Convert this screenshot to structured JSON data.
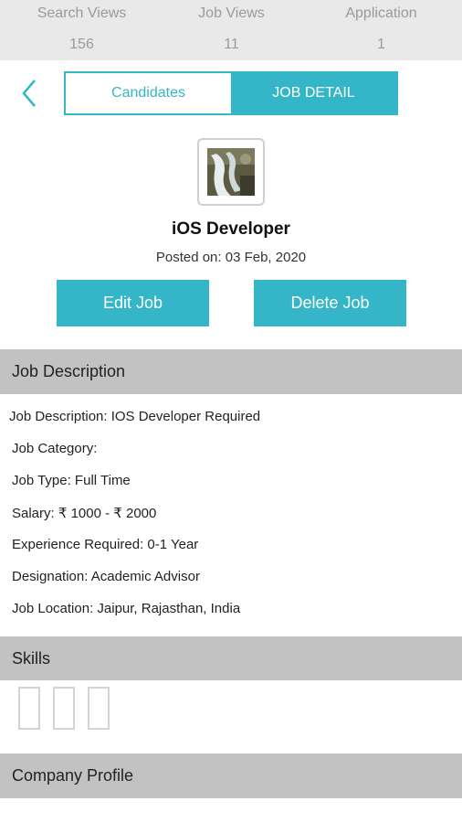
{
  "stats": [
    {
      "label": "Search Views",
      "value": "156"
    },
    {
      "label": "Job Views",
      "value": "11"
    },
    {
      "label": "Application",
      "value": "1"
    }
  ],
  "tabs": {
    "candidates": "Candidates",
    "job_detail": "JOB DETAIL"
  },
  "job": {
    "title": "iOS Developer",
    "posted": "Posted on: 03 Feb, 2020"
  },
  "actions": {
    "edit": "Edit Job",
    "delete": "Delete Job"
  },
  "sections": {
    "job_description": "Job Description",
    "skills": "Skills",
    "company_profile": "Company Profile"
  },
  "details": [
    "Job Description: IOS Developer Required",
    "Job Category:",
    "Job Type: Full Time",
    "Salary: ₹ 1000 - ₹ 2000",
    "Experience Required: 0-1 Year",
    "Designation: Academic Advisor",
    "Job Location: Jaipur, Rajasthan, India"
  ],
  "colors": {
    "accent": "#35b5c8",
    "section_bg": "#c2c2c2",
    "stats_bg": "#e9e9e9"
  },
  "icons": {
    "back": "chevron-left-icon",
    "thumbnail": "job-image"
  }
}
